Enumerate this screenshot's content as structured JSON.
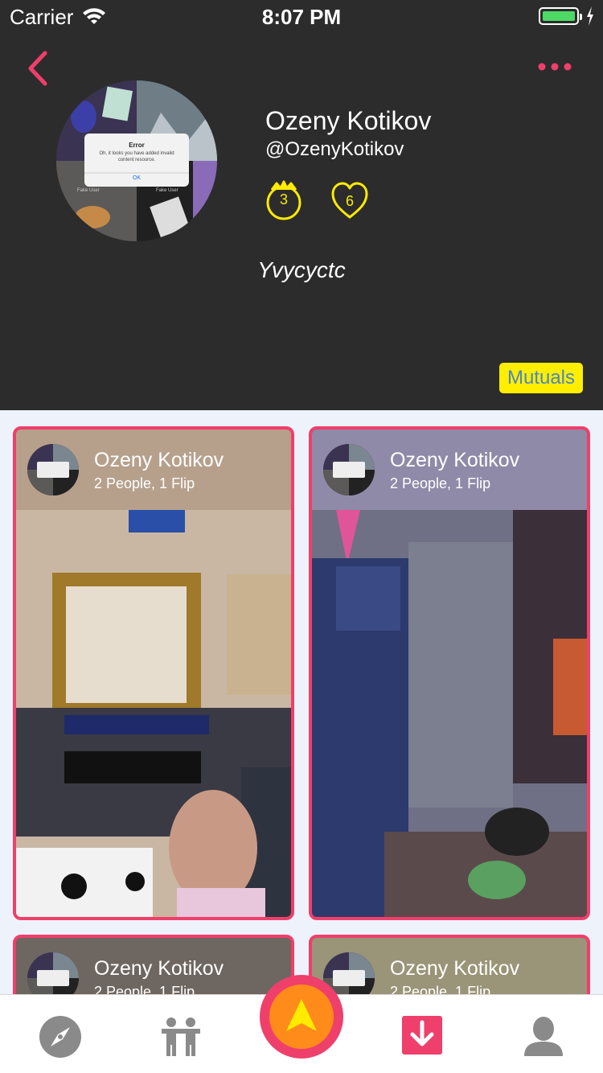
{
  "status_bar": {
    "carrier": "Carrier",
    "time": "8:07 PM"
  },
  "profile": {
    "name": "Ozeny Kotikov",
    "handle": "@OzenyKotikov",
    "crown_count": "3",
    "heart_count": "6",
    "bio": "Yvycyctc",
    "mutuals_label": "Mutuals",
    "avatar_dialog": {
      "title": "Error",
      "message": "Oh, it looks you have added invalid content resource.",
      "button": "OK",
      "tile_caption_left": "Fake User",
      "tile_caption_right": "Fake User"
    }
  },
  "cards": [
    {
      "name": "Ozeny Kotikov",
      "subtitle": "2 People, 1 Flip"
    },
    {
      "name": "Ozeny Kotikov",
      "subtitle": "2 People, 1 Flip"
    },
    {
      "name": "Ozeny Kotikov",
      "subtitle": "2 People, 1 Flip"
    },
    {
      "name": "Ozeny Kotikov",
      "subtitle": "2 People, 1 Flip"
    }
  ],
  "tab_bar": {
    "items": [
      "compass-icon",
      "people-icon",
      "create-icon",
      "download-icon",
      "profile-icon"
    ]
  },
  "colors": {
    "accent": "#ef3f6b",
    "header_bg": "#2c2c2c",
    "badge_yellow": "#ffee00",
    "mutuals_text": "#4a86c5",
    "fab_orange": "#ff8c1a"
  }
}
